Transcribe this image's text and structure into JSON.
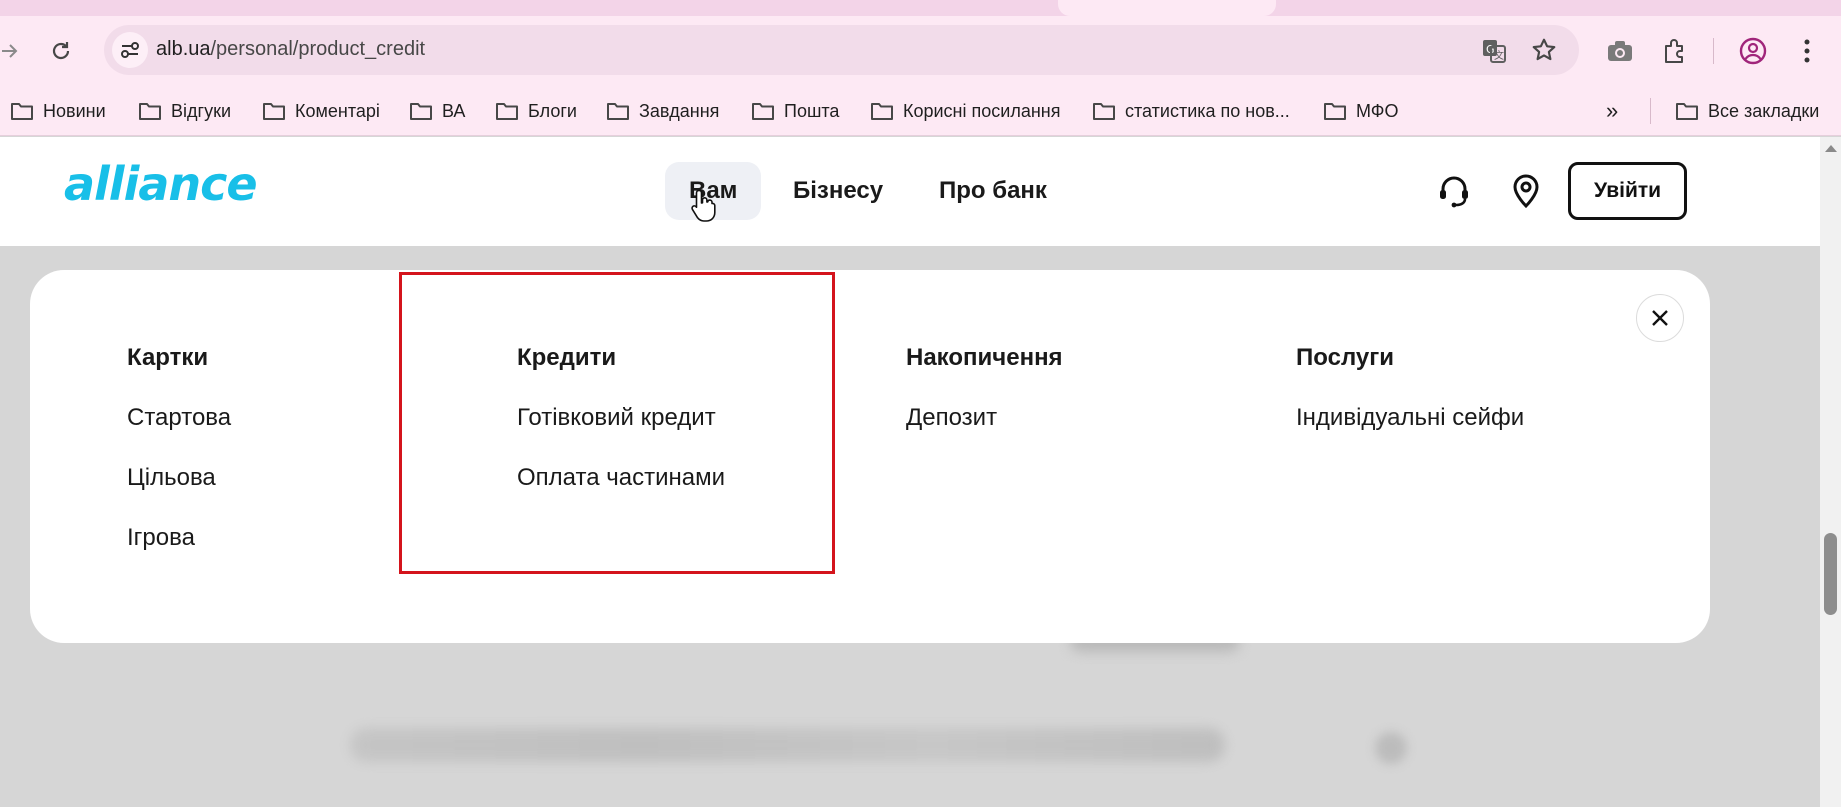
{
  "browser": {
    "url_host": "alb.ua",
    "url_path": "/personal/product_credit",
    "bookmarks": [
      "Новини",
      "Відгуки",
      "Коментарі",
      "ВА",
      "Блоги",
      "Завдання",
      "Пошта",
      "Корисні посилання",
      "статистика по нов...",
      "МФО"
    ],
    "all_bookmarks": "Все закладки",
    "overflow": "»"
  },
  "header": {
    "logo": "alliance",
    "nav": [
      "Вам",
      "Бізнесу",
      "Про банк"
    ],
    "login": "Увійти"
  },
  "menu": {
    "columns": [
      {
        "title": "Картки",
        "links": [
          "Стартова",
          "Цільова",
          "Ігрова"
        ]
      },
      {
        "title": "Кредити",
        "links": [
          "Готівковий кредит",
          "Оплата частинами"
        ]
      },
      {
        "title": "Накопичення",
        "links": [
          "Депозит"
        ]
      },
      {
        "title": "Послуги",
        "links": [
          "Індивідуальні сейфи"
        ]
      }
    ]
  },
  "colors": {
    "brand": "#18bfe8",
    "highlight": "#d4141c",
    "chrome": "#fde9f4"
  }
}
